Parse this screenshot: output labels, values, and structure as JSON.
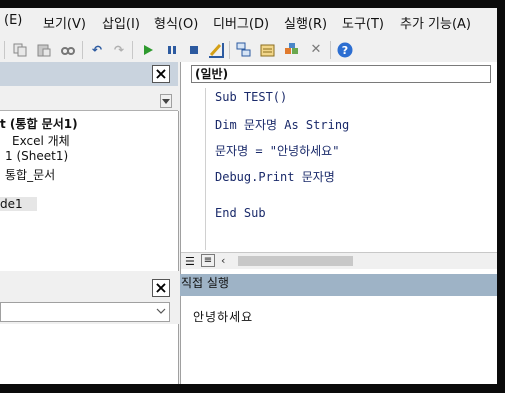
{
  "menu": {
    "items": [
      "(E)",
      "보기(V)",
      "삽입(I)",
      "형식(O)",
      "디버그(D)",
      "실행(R)",
      "도구(T)",
      "추가 기능(A)"
    ]
  },
  "toolbar": {
    "icons": [
      "copy-icon",
      "paste-icon",
      "find-icon",
      "undo-icon",
      "redo-icon",
      "run-icon",
      "break-icon",
      "reset-icon",
      "design-mode-icon",
      "project-explorer-icon",
      "properties-icon",
      "object-browser-icon",
      "toolbox-icon",
      "help-icon"
    ]
  },
  "project": {
    "tree": [
      "t (통합 문서1)",
      "Excel 개체",
      "1 (Sheet1)",
      "통합_문서",
      "de1"
    ]
  },
  "code": {
    "object_combo": "(일반)",
    "lines": [
      "Sub TEST()",
      "Dim 문자명 As String",
      "문자명 = \"안녕하세요\"",
      "Debug.Print 문자명",
      "End Sub"
    ]
  },
  "immediate": {
    "title": "직접 실행",
    "output": "안녕하세요"
  },
  "colors": {
    "panel_header": "#c9d3de",
    "immediate_header": "#9eb3c6",
    "code_text": "#1a2a6a"
  }
}
